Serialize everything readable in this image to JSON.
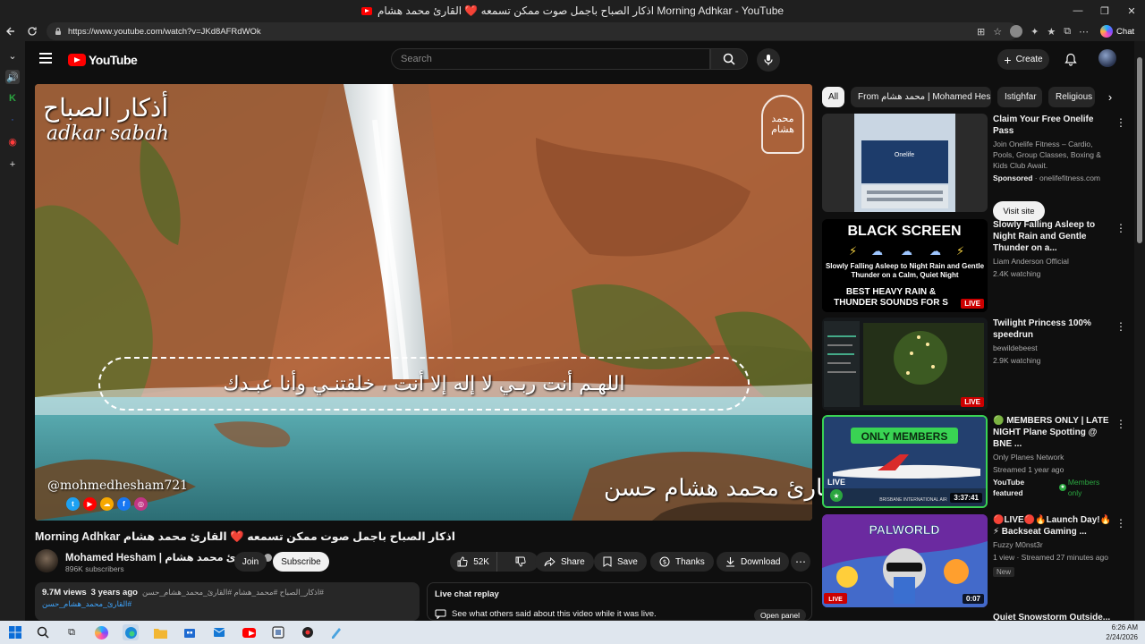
{
  "window": {
    "title": "اذكار الصباح باجمل صوت ممكن تسمعه ❤️ القارئ محمد هشام Morning Adhkar - YouTube",
    "controls": [
      "—",
      "❐",
      "✕"
    ]
  },
  "browser": {
    "url": "https://www.youtube.com/watch?v=JKd8AFRdWOk",
    "chat_label": "Chat"
  },
  "header": {
    "logo_text": "YouTube",
    "search_placeholder": "Search",
    "create_label": "Create"
  },
  "player": {
    "overlay_title_ar": "أذكار الصباح",
    "overlay_title_en": "adkar sabah",
    "dua_text": "اللهـم أنت ربـي لا إله إلا أنت ، خلقتنـي وأنا عبـدك",
    "handle": "@mohmedhesham721",
    "reciter": "القارئ محمد هشام حسن",
    "emblem_text": "محمد هشام"
  },
  "video": {
    "title": "اذكار الصباح باجمل صوت ممكن تسمعه ❤️ القارئ محمد هشام Morning Adhkar",
    "channel_name": "Mohamed Hesham | القارئ محمد هشام",
    "subscribers": "896K subscribers",
    "join_label": "Join",
    "subscribe_label": "Subscribe",
    "likes": "52K",
    "share_label": "Share",
    "save_label": "Save",
    "thanks_label": "Thanks",
    "download_label": "Download",
    "views": "9.7M views",
    "age": "3 years ago",
    "tags": "#اذكار_الصباح #محمد_هشام #القارئ_محمد_هشام_حسن",
    "tag_line2": "#القارئ_محمد_هشام_حسن"
  },
  "live_chat": {
    "title": "Live chat replay",
    "subtitle": "See what others said about this video while it was live.",
    "open_panel": "Open panel"
  },
  "chips": [
    "All",
    "From محمد هشام | Mohamed Hesham",
    "Istighfar",
    "Religious"
  ],
  "recommendations": [
    {
      "title": "Claim Your Free Onelife Pass",
      "line1": "Join Onelife Fitness – Cardio, Pools, Group Classes, Boxing & Kids Club Await.",
      "sponsored": "Sponsored",
      "domain": "· onelifefitness.com",
      "visit_label": "Visit site",
      "thumb_text": "Onelife"
    },
    {
      "title": "Slowly Falling Asleep to Night Rain and Gentle Thunder on a...",
      "channel": "Liam Anderson Official",
      "meta": "2.4K watching",
      "badge": "LIVE",
      "thumb_head": "BLACK SCREEN",
      "thumb_mid": "Slowly Falling Asleep to Night Rain and Gentle Thunder on a Calm, Quiet Night",
      "thumb_foot": "BEST HEAVY RAIN & THUNDER SOUNDS FOR S"
    },
    {
      "title": "Twilight Princess 100% speedrun",
      "channel": "bewildebeest",
      "meta": "2.9K watching",
      "badge": "LIVE"
    },
    {
      "title": "🟢 MEMBERS ONLY | LATE NIGHT Plane Spotting @ BNE ...",
      "channel": "Only Planes Network",
      "meta": "Streamed 1 year ago",
      "featured": "YouTube featured",
      "members": "Members only",
      "badge": "3:37:41",
      "thumb_head": "ONLY MEMBERS",
      "thumb_live": "LIVE",
      "thumb_foot": "BRISBANE INTERNATIONAL AIR"
    },
    {
      "title": "🔴LIVE🔴🔥Launch Day!🔥⚡ Backseat Gaming ...",
      "channel": "Fuzzy M0nst3r",
      "meta": "1 view · Streamed 27 minutes ago",
      "tag": "New",
      "badge": "0:07",
      "thumb_head": "PALWORLD",
      "thumb_live": "LIVE"
    },
    {
      "title": "Quiet Snowstorm Outside..."
    }
  ],
  "taskbar": {
    "time": "6:26 AM",
    "date": "2/24/2026"
  },
  "colors": {
    "background": "#0f0f0f",
    "surface": "#272727",
    "brand_red": "#ff0000",
    "link_blue": "#3ea6ff",
    "members_green": "#2ba640"
  }
}
